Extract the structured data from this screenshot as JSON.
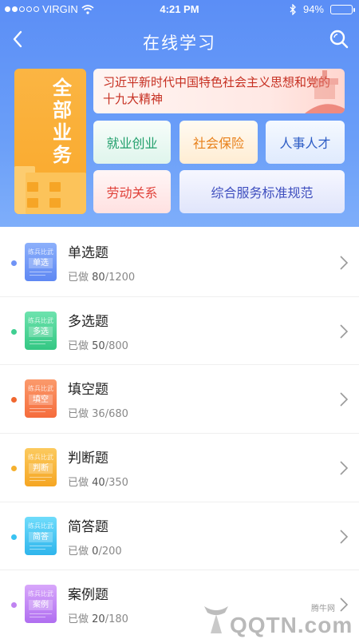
{
  "status_bar": {
    "carrier": "VIRGIN",
    "time": "4:21 PM",
    "battery": "94%",
    "battery_level": 0.94
  },
  "nav": {
    "title": "在线学习"
  },
  "top": {
    "all_business": "全部业务",
    "banner": "习近平新时代中国特色社会主义思想和党的十九大精神",
    "tiles": [
      "就业创业",
      "社会保险",
      "人事人才",
      "劳动关系",
      "综合服务标准规范"
    ]
  },
  "colors": {
    "header": "#5b8ef6",
    "single": "#6f93f6",
    "multi": "#3fcf91",
    "fill": "#f7744a",
    "judge": "#f8b236",
    "short": "#39c3f2",
    "case": "#c083f1"
  },
  "book_top_label": "练兵比武",
  "done_label": "已做",
  "questions": [
    {
      "title": "单选题",
      "tag": "单选",
      "done": "80",
      "total": "/1200"
    },
    {
      "title": "多选题",
      "tag": "多选",
      "done": "50",
      "total": "/800"
    },
    {
      "title": "填空题",
      "tag": "填空",
      "done": "36",
      "total": "/680"
    },
    {
      "title": "判断题",
      "tag": "判断",
      "done": "40",
      "total": "/350"
    },
    {
      "title": "简答题",
      "tag": "简答",
      "done": "0",
      "total": "/200"
    },
    {
      "title": "案例题",
      "tag": "案例",
      "done": "20",
      "total": "/180"
    }
  ],
  "watermark": {
    "small": "腾牛网",
    "big": "QQTN.com"
  }
}
